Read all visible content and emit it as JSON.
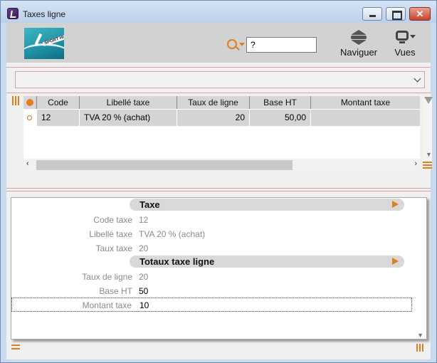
{
  "window": {
    "title": "Taxes ligne"
  },
  "toolbar": {
    "logo_text": "SPORT HUT",
    "search_value": "?",
    "navigate_label": "Naviguer",
    "views_label": "Vues"
  },
  "grid": {
    "columns": [
      "Code",
      "Libellé taxe",
      "Taux de ligne",
      "Base HT",
      "Montant taxe"
    ],
    "rows": [
      {
        "code": "12",
        "libelle": "TVA 20 % (achat)",
        "taux": "20",
        "base": "50,00",
        "montant": ""
      }
    ]
  },
  "form": {
    "section_taxe": "Taxe",
    "code_label": "Code taxe",
    "code_value": "12",
    "libelle_label": "Libellé taxe",
    "libelle_value": "TVA 20 % (achat)",
    "taux_label": "Taux taxe",
    "taux_value": "20",
    "section_totaux": "Totaux taxe ligne",
    "taux_ligne_label": "Taux de ligne",
    "taux_ligne_value": "20",
    "base_label": "Base HT",
    "base_value": "50",
    "montant_label": "Montant taxe",
    "montant_value": "10"
  },
  "colors": {
    "accent": "#e07f1f",
    "header_bg": "#d6d6d6",
    "divider": "#d9a1a1"
  }
}
